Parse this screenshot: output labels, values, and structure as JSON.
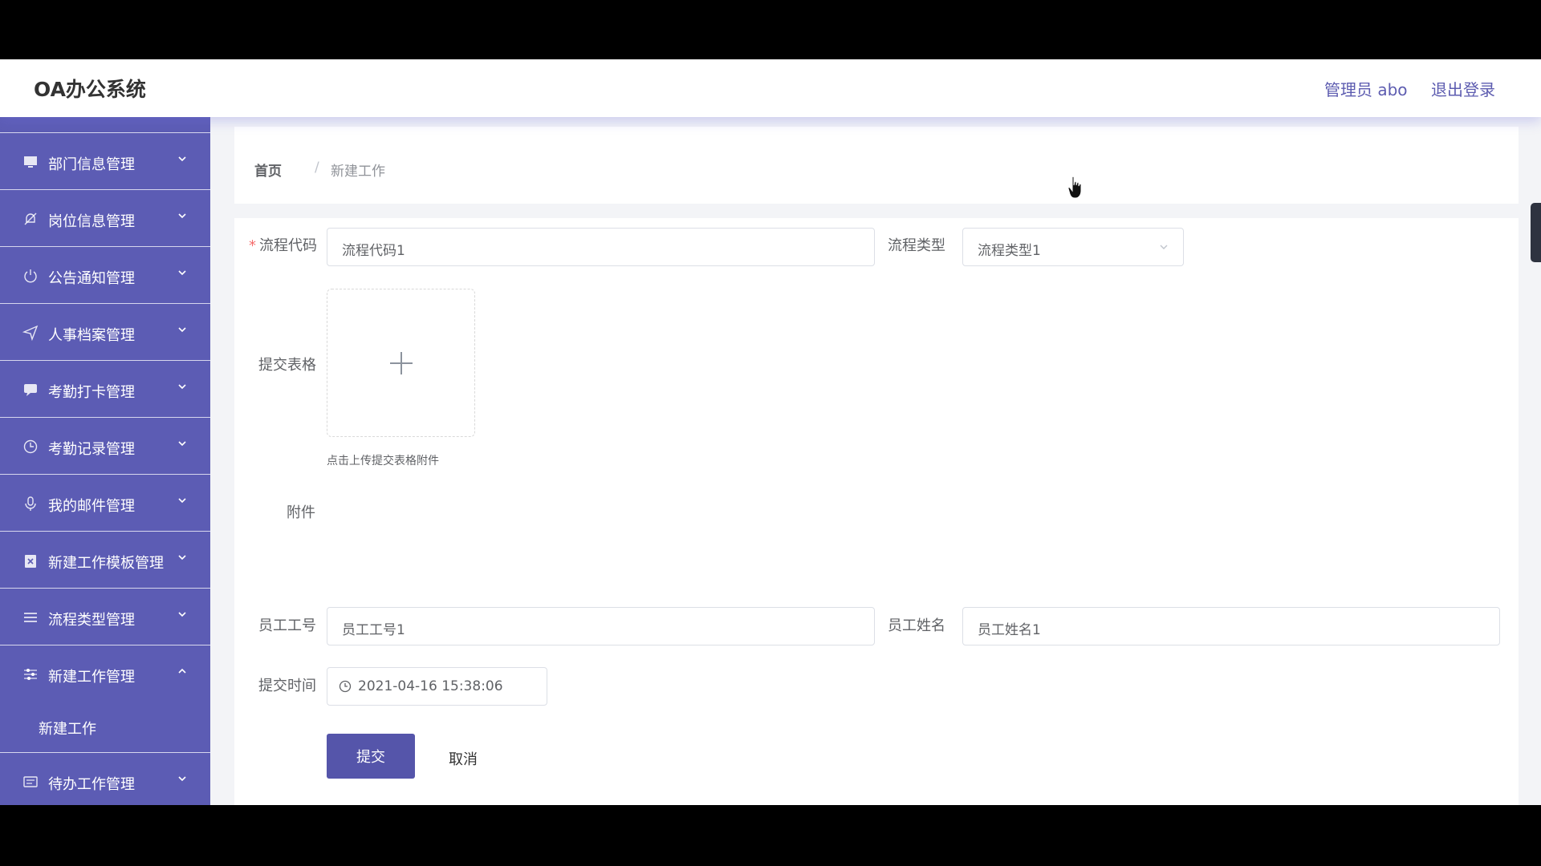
{
  "header": {
    "logo": "OA办公系统",
    "user": "管理员 abo",
    "logout": "退出登录"
  },
  "sidebar": {
    "items": [
      {
        "label": "部门信息管理",
        "icon": "monitor-icon"
      },
      {
        "label": "岗位信息管理",
        "icon": "bell-off-icon"
      },
      {
        "label": "公告通知管理",
        "icon": "power-icon"
      },
      {
        "label": "人事档案管理",
        "icon": "send-icon"
      },
      {
        "label": "考勤打卡管理",
        "icon": "chat-icon"
      },
      {
        "label": "考勤记录管理",
        "icon": "clock-icon"
      },
      {
        "label": "我的邮件管理",
        "icon": "microphone-icon"
      },
      {
        "label": "新建工作模板管理",
        "icon": "clipboard-icon"
      },
      {
        "label": "流程类型管理",
        "icon": "list-icon"
      },
      {
        "label": "新建工作管理",
        "icon": "sliders-icon",
        "open": true,
        "children": [
          "新建工作"
        ]
      },
      {
        "label": "待办工作管理",
        "icon": "message-box-icon"
      }
    ]
  },
  "breadcrumb": {
    "home": "首页",
    "separator": "/",
    "current": "新建工作"
  },
  "form": {
    "process_code": {
      "label": "流程代码",
      "value": "流程代码1"
    },
    "process_type": {
      "label": "流程类型",
      "value": "流程类型1"
    },
    "submit_form": {
      "label": "提交表格",
      "tip": "点击上传提交表格附件"
    },
    "attachment": {
      "label": "附件"
    },
    "employee_no": {
      "label": "员工工号",
      "value": "员工工号1"
    },
    "employee_name": {
      "label": "员工姓名",
      "value": "员工姓名1"
    },
    "submit_time": {
      "label": "提交时间",
      "value": "2021-04-16 15:38:06"
    },
    "submit_button": "提交",
    "cancel_button": "取消"
  },
  "colors": {
    "sidebar_bg": "#5c5cb4",
    "primary": "#5555aa",
    "header_text": "#5d5cb0"
  }
}
